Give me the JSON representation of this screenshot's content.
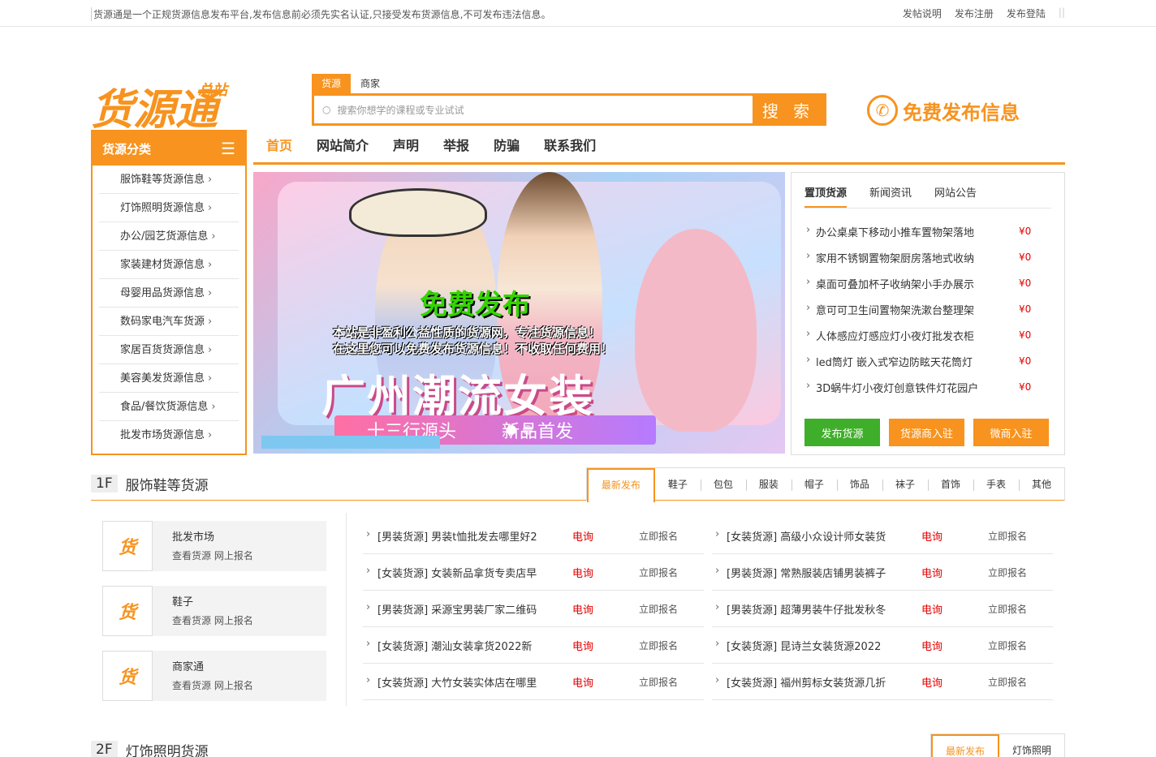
{
  "topbar": {
    "notice": "货源通是一个正规货源信息发布平台,发布信息前必须先实名认证,只接受发布货源信息,不可发布违法信息。",
    "links": [
      "发帖说明",
      "发布注册",
      "发布登陆"
    ]
  },
  "logo": {
    "main": "货源通",
    "sub": "总站"
  },
  "search": {
    "tabs": [
      "货源",
      "商家"
    ],
    "placeholder": "搜索你想学的课程或专业试试",
    "button": "搜 索"
  },
  "publish": {
    "label": "免费发布信息"
  },
  "category": {
    "title": "货源分类",
    "items": [
      "服饰鞋等货源信息",
      "灯饰照明货源信息",
      "办公/园艺货源信息",
      "家装建材货源信息",
      "母婴用品货源信息",
      "数码家电汽车货源",
      "家居百货货源信息",
      "美容美发货源信息",
      "食品/餐饮货源信息",
      "批发市场货源信息"
    ]
  },
  "nav": [
    "首页",
    "网站简介",
    "声明",
    "举报",
    "防骗",
    "联系我们"
  ],
  "banner": {
    "line1": "免费发布",
    "line2": "本站是非盈利公益性质的货源网，专注货源信息！",
    "line3": "在这里您可以免费发布货源信息！不收取任何费用！",
    "line4": "广州潮流女装",
    "tag1": "十三行源头",
    "tag2": "新品首发"
  },
  "side": {
    "tabs": [
      "置顶货源",
      "新闻资讯",
      "网站公告"
    ],
    "items": [
      {
        "t": "办公桌桌下移动小推车置物架落地",
        "p": "¥0"
      },
      {
        "t": "家用不锈钢置物架厨房落地式收纳",
        "p": "¥0"
      },
      {
        "t": "桌面可叠加杯子收纳架小手办展示",
        "p": "¥0"
      },
      {
        "t": "意可可卫生间置物架洗漱台整理架",
        "p": "¥0"
      },
      {
        "t": "人体感应灯感应灯小夜灯批发衣柜",
        "p": "¥0"
      },
      {
        "t": "led筒灯 嵌入式窄边防眩天花筒灯",
        "p": "¥0"
      },
      {
        "t": "3D蜗牛灯小夜灯创意铁件灯花园户",
        "p": "¥0"
      }
    ],
    "buttons": [
      {
        "label": "发布货源",
        "color": "#3fae2a"
      },
      {
        "label": "货源商入驻",
        "color": "#f7931e"
      },
      {
        "label": "微商入驻",
        "color": "#f7931e"
      }
    ]
  },
  "floor1": {
    "num": "1F",
    "name": "服饰鞋等货源",
    "tabs": [
      "最新发布",
      "鞋子",
      "包包",
      "服装",
      "帽子",
      "饰品",
      "袜子",
      "首饰",
      "手表",
      "其他"
    ],
    "markets": [
      {
        "logo": "货",
        "name": "批发市场",
        "sub": "查看货源 网上报名"
      },
      {
        "logo": "货",
        "name": "鞋子",
        "sub": "查看货源 网上报名"
      },
      {
        "logo": "货",
        "name": "商家通",
        "sub": "查看货源 网上报名"
      }
    ],
    "items": [
      {
        "t": "[男装货源] 男装t恤批发去哪里好2",
        "c": "电询",
        "a": "立即报名"
      },
      {
        "t": "[女装货源] 高级小众设计师女装货",
        "c": "电询",
        "a": "立即报名"
      },
      {
        "t": "[女装货源] 女装新品拿货专卖店早",
        "c": "电询",
        "a": "立即报名"
      },
      {
        "t": "[男装货源] 常熟服装店铺男装裤子",
        "c": "电询",
        "a": "立即报名"
      },
      {
        "t": "[男装货源] 采源宝男装厂家二维码",
        "c": "电询",
        "a": "立即报名"
      },
      {
        "t": "[男装货源] 超薄男装牛仔批发秋冬",
        "c": "电询",
        "a": "立即报名"
      },
      {
        "t": "[女装货源] 潮汕女装拿货2022新",
        "c": "电询",
        "a": "立即报名"
      },
      {
        "t": "[女装货源] 昆诗兰女装货源2022",
        "c": "电询",
        "a": "立即报名"
      },
      {
        "t": "[女装货源] 大竹女装实体店在哪里",
        "c": "电询",
        "a": "立即报名"
      },
      {
        "t": "[女装货源] 福州剪标女装货源几折",
        "c": "电询",
        "a": "立即报名"
      }
    ]
  },
  "floor2": {
    "num": "2F",
    "name": "灯饰照明货源",
    "tabs": [
      "最新发布",
      "灯饰照明"
    ]
  },
  "colors": {
    "accent": "#f7931e",
    "price": "#e30000",
    "green": "#3fae2a"
  }
}
